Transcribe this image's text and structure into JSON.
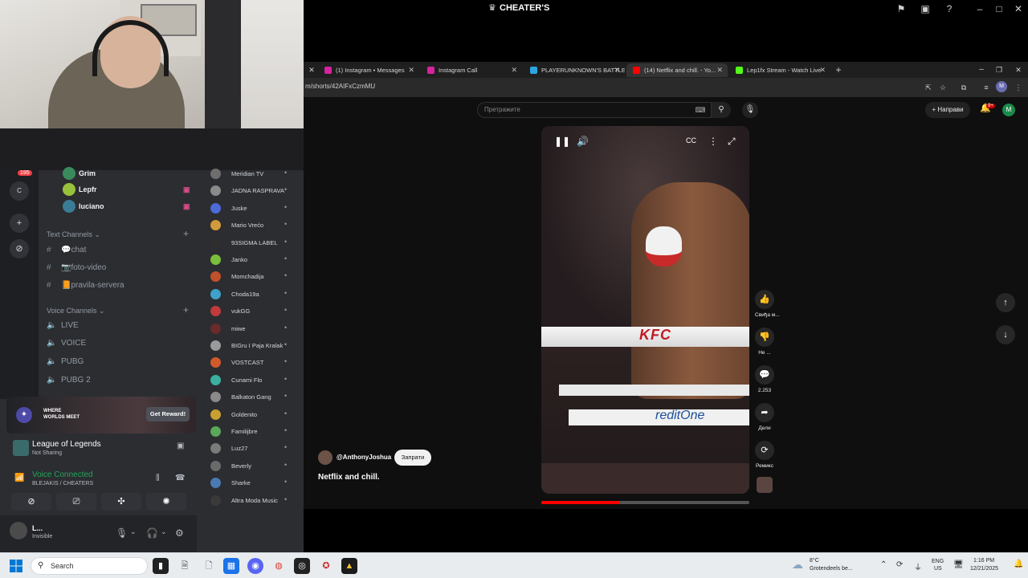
{
  "window": {
    "title": "CHEATER'S"
  },
  "browser": {
    "tabs": [
      {
        "label": "(1) Instagram • Messages",
        "color": "#d6249f"
      },
      {
        "label": "Instagram Call",
        "color": "#d6249f"
      },
      {
        "label": "PLAYERUNKNOWN'S BATTLE...",
        "color": "#2aa7e0"
      },
      {
        "label": "(14) Netflix and chill. - Yo...",
        "color": "#ff0000",
        "active": true
      },
      {
        "label": "Lep1fx Stream - Watch Live",
        "color": "#53fc18"
      }
    ],
    "url": "m/shorts/42AIFxCzmMU"
  },
  "youtube": {
    "search_placeholder": "Претражите",
    "create_label": "Направи",
    "notification_count": "9+",
    "avatar_letter": "M",
    "actions": {
      "like": "Свиђа м...",
      "dislike": "Не ...",
      "comments": "2.253",
      "share": "Дели",
      "remix": "Ремикс"
    },
    "channel": "@AnthonyJoshua",
    "subscribe": "Запрати",
    "video_title": "Netflix and chill.",
    "ring_sponsor_1": "KFC",
    "ring_sponsor_2": "reditOne",
    "progress": 0.38
  },
  "discord": {
    "server_badge": "195",
    "server_label": "C",
    "voice_users": [
      {
        "name": "Grim",
        "color": "#3a8b5c"
      },
      {
        "name": "Lepfr",
        "color": "#98c23c"
      },
      {
        "name": "luciano",
        "color": "#3a7c96"
      }
    ],
    "text_category": "Text Channels",
    "text_channels": [
      "💬chat",
      "📷foto-video",
      "📙pravila-servera"
    ],
    "voice_category": "Voice Channels",
    "voice_channels": [
      "LIVE",
      "VOICE",
      "PUBG",
      "PUBG 2"
    ],
    "promo": {
      "brand": "WHERE WORLDS MEET",
      "button": "Get Reward!"
    },
    "activity": {
      "game": "League of Legends",
      "status": "Not Sharing"
    },
    "voice": {
      "status": "Voice Connected",
      "location": "BLEJAKIS / CHEATERS"
    },
    "user": {
      "name": "L...",
      "status": "Invisible"
    },
    "members": [
      "Meridian TV",
      "JADNA RASPRAVA",
      "Juske",
      "Mario Vrećo",
      "93SIGMA LABEL",
      "Janko",
      "Momchadija",
      "Choda19a",
      "vukGG",
      "miwe",
      "BIGru I Paja Kralak",
      "VOSTCAST",
      "Cunami Flo",
      "Balkaton Gang",
      "Goldenito",
      "Familijbre",
      "Luz27",
      "Beverly",
      "Sharke",
      "Altra Moda Music"
    ]
  },
  "taskbar": {
    "search_label": "Search",
    "weather_temp": "8°C",
    "weather_condition": "Grotendeels be...",
    "lang_1": "ENG",
    "lang_2": "US",
    "time": "1:16 PM",
    "date": "12/21/2025"
  }
}
